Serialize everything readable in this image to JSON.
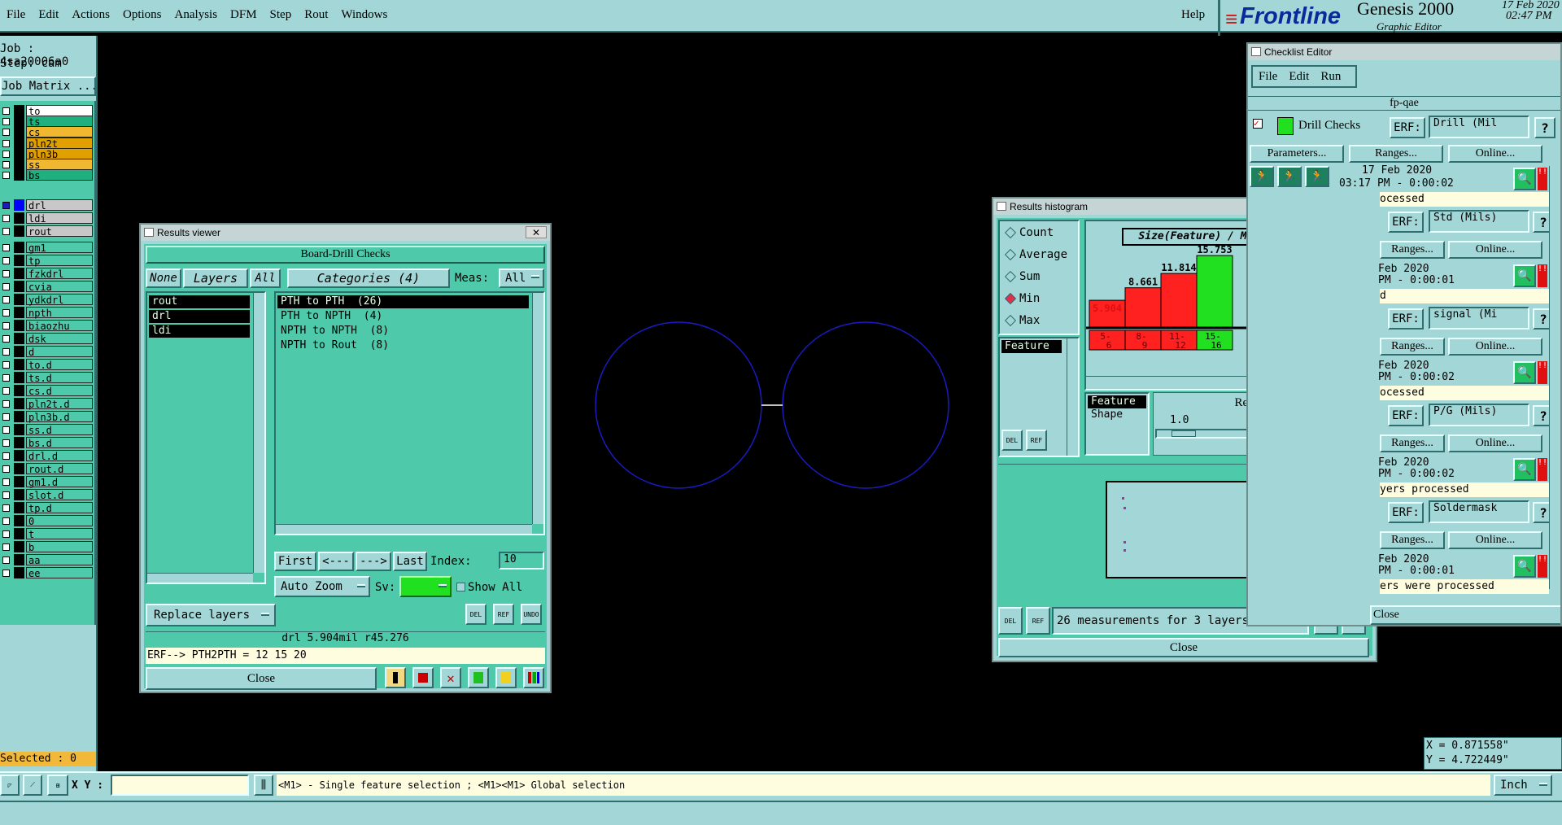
{
  "menubar": {
    "items": [
      "File",
      "Edit",
      "Actions",
      "Options",
      "Analysis",
      "DFM",
      "Step",
      "Rout",
      "Windows"
    ],
    "help": "Help",
    "brand": "Frontline",
    "product": "Genesis 2000",
    "subtitle": "Graphic Editor",
    "date": "17 Feb 2020",
    "time": "02:47 PM"
  },
  "left_panel": {
    "job": "Job : 4sa20006a0",
    "step": "Step: cam",
    "job_matrix": "Job Matrix ...",
    "group1": [
      {
        "name": "to",
        "color": "#ffffff"
      },
      {
        "name": "ts",
        "color": "#20b080"
      },
      {
        "name": "cs",
        "color": "#f0b830"
      },
      {
        "name": "pln2t",
        "color": "#e0a000"
      },
      {
        "name": "pln3b",
        "color": "#e0a000"
      },
      {
        "name": "ss",
        "color": "#f0b830"
      },
      {
        "name": "bs",
        "color": "#20b080"
      }
    ],
    "group2": [
      {
        "name": "drl",
        "color": "#c8c8c8"
      },
      {
        "name": "ldi",
        "color": "#c8c8c8"
      },
      {
        "name": "rout",
        "color": "#c8c8c8"
      }
    ],
    "group3": [
      "gm1",
      "tp",
      "fzkdrl",
      "cvia",
      "ydkdrl",
      "npth",
      "biaozhu",
      "dsk",
      "d",
      "to.d",
      "ts.d",
      "cs.d",
      "pln2t.d",
      "pln3b.d",
      "ss.d",
      "bs.d",
      "drl.d",
      "rout.d",
      "gm1.d",
      "slot.d",
      "tp.d",
      "0",
      "t",
      "b",
      "aa",
      "ee"
    ],
    "selected": "Selected : 0"
  },
  "results_viewer": {
    "title": "Results viewer",
    "header": "Board-Drill Checks",
    "none_btn": "None",
    "layers_btn": "Layers",
    "all_btn": "All",
    "categories_btn": "Categories (4)",
    "meas_label": "Meas:",
    "meas_value": "All",
    "layers": [
      "rout",
      "drl",
      "ldi"
    ],
    "categories": [
      "PTH to PTH  (26)",
      "PTH to NPTH  (4)",
      "NPTH to NPTH  (8)",
      "NPTH to Rout  (8)"
    ],
    "first": "First",
    "prev": "<---",
    "next": "--->",
    "last": "Last",
    "index_label": "Index:",
    "index_value": "10",
    "auto_zoom": "Auto Zoom",
    "sv_label": "Sv:",
    "show_all": "Show All",
    "replace_layers": "Replace layers",
    "status": "drl 5.904mil  r45.276",
    "erf": "ERF--> PTH2PTH = 12 15 20",
    "close": "Close",
    "del": "DEL",
    "ref": "REF",
    "undo": "UNDO"
  },
  "results_histogram": {
    "title": "Results histogram",
    "options": [
      "Count",
      "Average",
      "Sum",
      "Min",
      "Max"
    ],
    "selected_option": "Min",
    "list_items": [
      "Feature"
    ],
    "chart_title": "Size(Feature) / Min(Feature)",
    "shape_list": [
      "Feature",
      "Shape"
    ],
    "resolution_label": "Resolution",
    "resolution_value": "1.0",
    "measurements": "26 measurements for 3 layers",
    "close": "Close",
    "del": "DEL",
    "ref": "REF"
  },
  "chart_data": {
    "type": "bar",
    "title": "Size(Feature) / Min(Feature)",
    "categories": [
      "5-6",
      "8-9",
      "11-12",
      "15-16"
    ],
    "values": [
      5.904,
      8.661,
      11.814,
      15.753
    ],
    "colors": [
      "#ff2020",
      "#ff2020",
      "#ff2020",
      "#20e020"
    ],
    "bin_labels": [
      [
        "5-",
        "6"
      ],
      [
        "8-",
        "9"
      ],
      [
        "11-",
        "12"
      ],
      [
        "15-",
        "16"
      ]
    ],
    "value_labels": [
      "5.904",
      "8.661",
      "11.814",
      "15.753"
    ],
    "ylim": [
      0,
      16.5
    ]
  },
  "checklist_editor": {
    "title": "Checklist Editor",
    "menu": [
      "File",
      "Edit",
      "Run"
    ],
    "name": "fp-qae",
    "check_name": "Drill Checks",
    "erf_label": "ERF:",
    "params": "Parameters...",
    "ranges": "Ranges...",
    "online": "Online...",
    "rows": [
      {
        "erf": "Drill (Mil",
        "date": "17 Feb 2020",
        "time": "03:17 PM - 0:00:02",
        "status": "ocessed"
      },
      {
        "erf": "Std (Mils)",
        "date": "Feb 2020",
        "time": "PM - 0:00:01",
        "status": "d"
      },
      {
        "erf": "signal (Mi",
        "date": "Feb 2020",
        "time": "PM - 0:00:02",
        "status": "ocessed"
      },
      {
        "erf": "P/G (Mils)",
        "date": "Feb 2020",
        "time": "PM - 0:00:02",
        "status": "yers processed"
      },
      {
        "erf": "Soldermask",
        "date": "Feb 2020",
        "time": "PM - 0:00:01",
        "status": "ers were processed"
      }
    ],
    "close": "Close"
  },
  "coords": {
    "x": "X = 0.871558\"",
    "y": "Y = 4.722449\""
  },
  "bottom_bar": {
    "xy_label": "X Y :",
    "hint": "<M1> - Single feature selection ; <M1><M1> Global selection",
    "units": "Inch"
  }
}
